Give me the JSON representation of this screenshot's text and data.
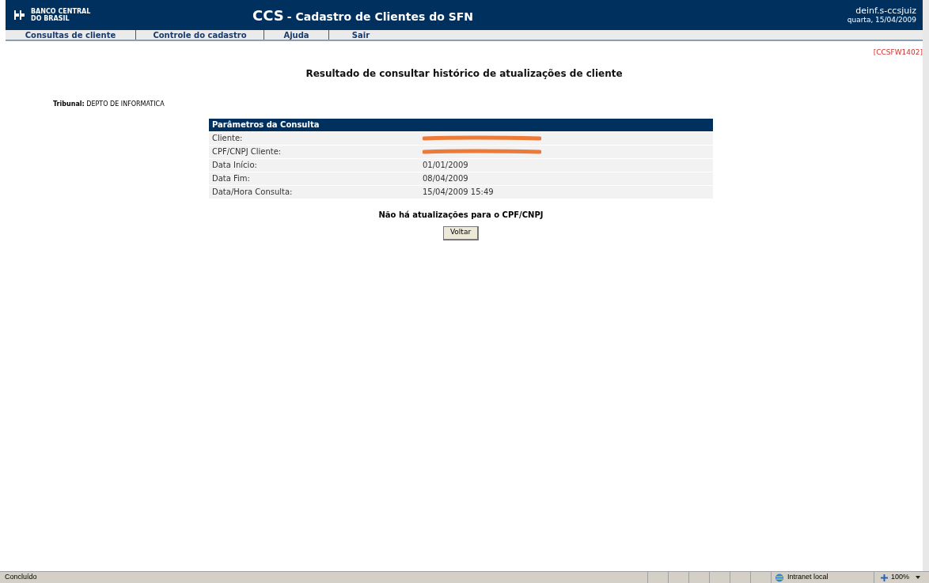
{
  "header": {
    "logo": [
      "BANCO CENTRAL",
      "DO BRASIL"
    ],
    "title_strong": "CCS",
    "title": "- Cadastro de Clientes do SFN",
    "user": "deinf.s-ccsjuiz",
    "date": "quarta, 15/04/2009"
  },
  "menu": [
    "Consultas de cliente",
    "Controle do cadastro",
    "Ajuda",
    "Sair"
  ],
  "screen_code": "[CCSFW1402]",
  "page_title": "Resultado de consultar histórico de atualizações de cliente",
  "tribunal": {
    "label": "Tribunal:",
    "value": "DEPTO DE INFORMATICA"
  },
  "parameters": {
    "heading": "Parâmetros da Consulta",
    "rows": [
      {
        "label": "Cliente:",
        "redacted": true
      },
      {
        "label": "CPF/CNPJ Cliente:",
        "redacted": true
      },
      {
        "label": "Data Início:",
        "value": "01/01/2009",
        "redacted": false
      },
      {
        "label": "Data Fim:",
        "value": "08/04/2009",
        "redacted": false
      },
      {
        "label": "Data/Hora Consulta:",
        "value": "15/04/2009 15:49",
        "redacted": false
      }
    ]
  },
  "message": "Não há atualizações para o CPF/CNPJ",
  "buttons": [
    "Voltar"
  ],
  "status_bar": {
    "text": "Concluído",
    "zone": "Intranet local",
    "zoom": "100%"
  }
}
